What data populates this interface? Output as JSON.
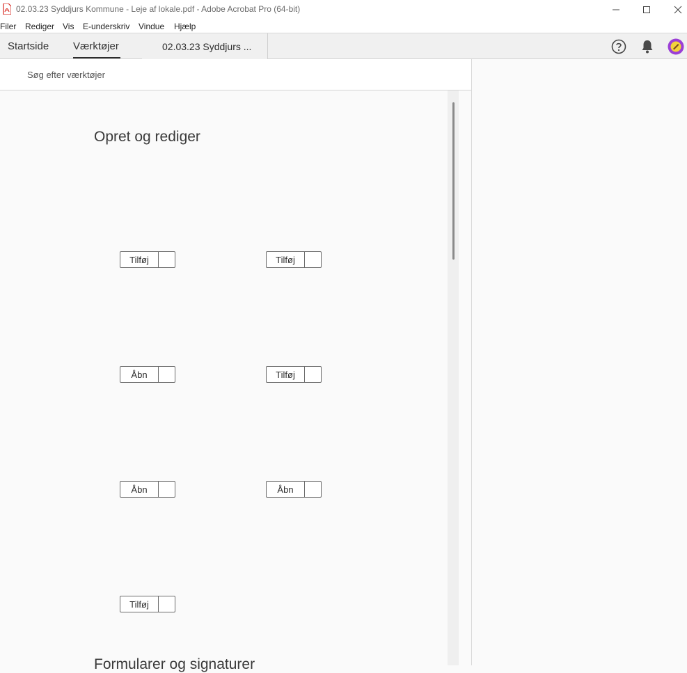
{
  "window": {
    "title": "02.03.23 Syddjurs Kommune - Leje af lokale.pdf - Adobe Acrobat Pro (64-bit)",
    "app_icon": "acrobat-pdf-icon",
    "controls": [
      "minimize-icon",
      "maximize-icon",
      "close-icon"
    ]
  },
  "menu": {
    "items": [
      "Filer",
      "Rediger",
      "Vis",
      "E-underskriv",
      "Vindue",
      "Hjælp"
    ]
  },
  "tabs": {
    "home": "Startside",
    "tools": "Værktøjer",
    "document": "02.03.23 Syddjurs ...",
    "active": "Værktøjer"
  },
  "top_icons": [
    "help-icon",
    "bell-icon",
    "profile-avatar-icon"
  ],
  "search": {
    "placeholder": "Søg efter værktøjer"
  },
  "sections": [
    {
      "title": "Opret og rediger",
      "buttons": [
        "Tilføj",
        "Tilføj",
        "Åbn",
        "Tilføj",
        "Åbn",
        "Åbn",
        "Tilføj"
      ]
    },
    {
      "title": "Formularer og signaturer"
    }
  ],
  "colors": {
    "accent_red": "#d7261e",
    "avatar_purple": "#9b3fd6",
    "avatar_yellow": "#f2d33c"
  }
}
